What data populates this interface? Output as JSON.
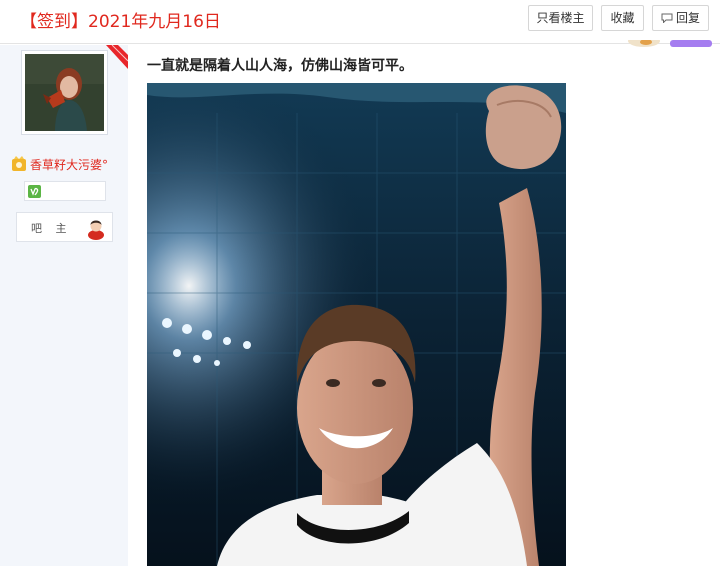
{
  "thread": {
    "title": "【签到】2021年九月16日"
  },
  "toolbar": {
    "only_owner_label": "只看楼主",
    "favorite_label": "收藏",
    "reply_label": "回复",
    "reply_icon": "comment-icon"
  },
  "user": {
    "avatar_icon": "user-avatar-photo",
    "badge_icon": "member-badge-icon",
    "name": "香草籽大污婆°",
    "level_icon": "capricorn-icon",
    "role_label": "吧 主",
    "role_icon": "forum-owner-icon"
  },
  "post": {
    "text": "一直就是隔着人山人海，仿佛山海皆可平。",
    "image_icon": "stadium-player-photo"
  },
  "colors": {
    "accent_red": "#e0281e",
    "panel_bg": "#f3f6fb"
  }
}
